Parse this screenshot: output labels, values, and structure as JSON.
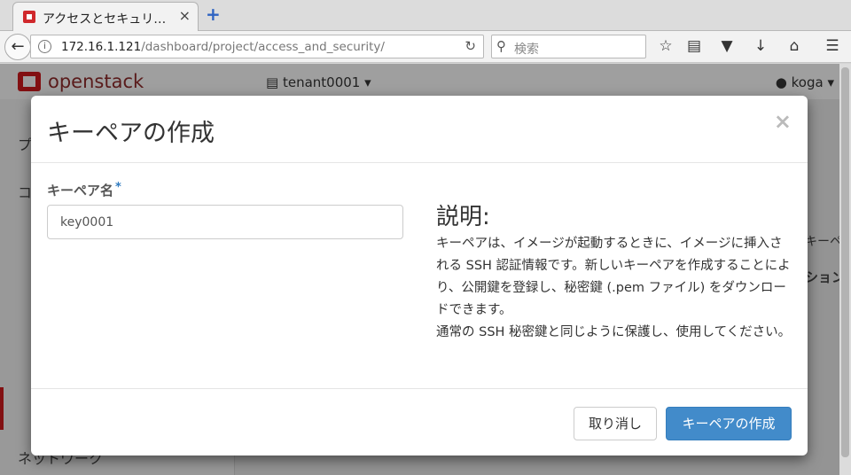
{
  "browser": {
    "tab_title": "アクセスとセキュリ…",
    "tab_close": "×",
    "new_tab": "+",
    "url_host": "172.16.1.121",
    "url_path": "/dashboard/project/access_and_security/",
    "search_placeholder": "検索",
    "icons": [
      "back-icon",
      "info-icon",
      "reload-icon",
      "search-icon",
      "bookmark-star-icon",
      "reading-list-icon",
      "pocket-icon",
      "download-icon",
      "home-icon",
      "menu-icon"
    ]
  },
  "page": {
    "logo_text": "openstack",
    "project_selector": "tenant0001",
    "user": "koga",
    "sidebar_peek": [
      "プ",
      "コ",
      "ネットワーク"
    ],
    "right_peek": [
      "キーペ",
      "ション"
    ]
  },
  "modal": {
    "title": "キーペアの作成",
    "close_label": "×",
    "field_label": "キーペア名",
    "required_mark": "*",
    "input_value": "key0001",
    "help_title": "説明:",
    "help_paragraph_1": "キーペアは、イメージが起動するときに、イメージに挿入される SSH 認証情報です。新しいキーペアを作成することにより、公開鍵を登録し、秘密鍵 (.pem ファイル) をダウンロードできます。",
    "help_paragraph_2": "通常の SSH 秘密鍵と同じように保護し、使用してください。",
    "cancel_label": "取り消し",
    "submit_label": "キーペアの作成"
  },
  "colors": {
    "primary": "#428bca",
    "brand_red": "#c8191c"
  }
}
